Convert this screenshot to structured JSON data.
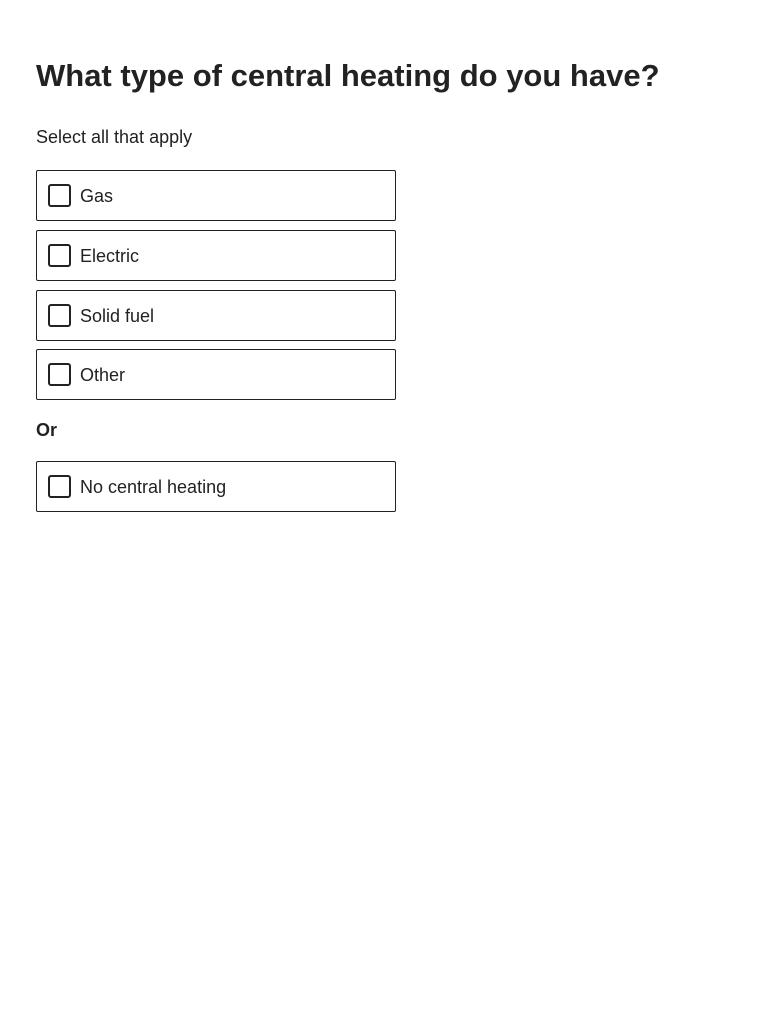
{
  "question": {
    "title": "What type of central heating do you have?",
    "hint": "Select all that apply"
  },
  "options": [
    {
      "label": "Gas",
      "checked": false
    },
    {
      "label": "Electric",
      "checked": false
    },
    {
      "label": "Solid fuel",
      "checked": false
    },
    {
      "label": "Other",
      "checked": false
    }
  ],
  "divider_label": "Or",
  "exclusive_option": {
    "label": "No central heating",
    "checked": false
  },
  "colors": {
    "text": "#222222",
    "border": "#222222",
    "background": "#ffffff"
  }
}
